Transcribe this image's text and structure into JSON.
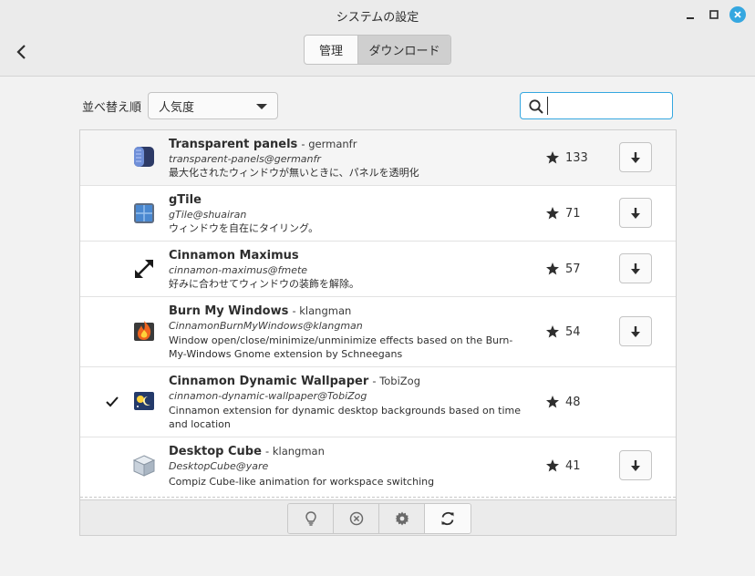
{
  "window": {
    "title": "システムの設定"
  },
  "header": {
    "tabs": [
      {
        "label": "管理"
      },
      {
        "label": "ダウンロード"
      }
    ]
  },
  "toolbar": {
    "sort_label": "並べ替え順",
    "sort_value": "人気度",
    "search_value": ""
  },
  "extensions": [
    {
      "name": "Transparent panels",
      "author": "- germanfr",
      "uuid": "transparent-panels@germanfr",
      "description": "最大化されたウィンドウが無いときに、パネルを透明化",
      "score": "133",
      "installed": false
    },
    {
      "name": "gTile",
      "author": "",
      "uuid": "gTile@shuairan",
      "description": "ウィンドウを自在にタイリング。",
      "score": "71",
      "installed": false
    },
    {
      "name": "Cinnamon Maximus",
      "author": "",
      "uuid": "cinnamon-maximus@fmete",
      "description": "好みに合わせてウィンドウの装飾を解除。",
      "score": "57",
      "installed": false
    },
    {
      "name": "Burn My Windows",
      "author": "- klangman",
      "uuid": "CinnamonBurnMyWindows@klangman",
      "description": "Window open/close/minimize/unminimize effects based on the Burn-My-Windows Gnome extension by Schneegans",
      "score": "54",
      "installed": false
    },
    {
      "name": "Cinnamon Dynamic Wallpaper",
      "author": "- TobiZog",
      "uuid": "cinnamon-dynamic-wallpaper@TobiZog",
      "description": "Cinnamon extension for dynamic desktop backgrounds based on time and location",
      "score": "48",
      "installed": true
    },
    {
      "name": "Desktop Cube",
      "author": "- klangman",
      "uuid": "DesktopCube@yare",
      "description": "Compiz Cube-like animation for workspace switching",
      "score": "41",
      "installed": false
    }
  ],
  "icons": {
    "back": "back-arrow-icon",
    "minimize": "minimize-icon",
    "maximize": "maximize-icon",
    "close": "close-icon",
    "search": "search-icon",
    "star": "star-icon",
    "download": "download-icon",
    "check": "check-icon",
    "tools": [
      "lightbulb-icon",
      "remove-icon",
      "gear-icon",
      "refresh-icon"
    ]
  },
  "colors": {
    "accent": "#35a7e0",
    "window_bg": "#f2f2f2",
    "list_bg": "#ffffff"
  }
}
